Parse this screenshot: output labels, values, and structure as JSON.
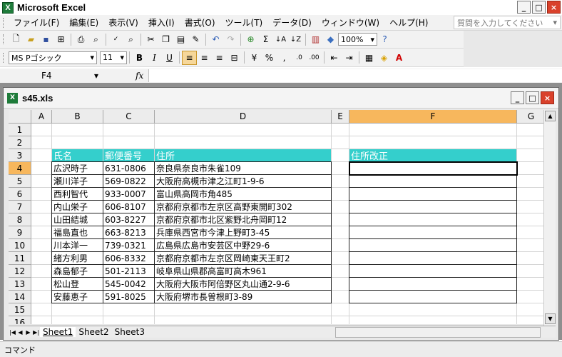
{
  "window": {
    "title": "Microsoft Excel"
  },
  "menu": [
    "ファイル(F)",
    "編集(E)",
    "表示(V)",
    "挿入(I)",
    "書式(O)",
    "ツール(T)",
    "データ(D)",
    "ウィンドウ(W)",
    "ヘルプ(H)"
  ],
  "help_placeholder": "質問を入力してください",
  "toolbar": {
    "zoom": "100%",
    "font_name": "MS Pゴシック",
    "font_size": "11"
  },
  "formula": {
    "name_box": "F4",
    "fx": "fx",
    "value": ""
  },
  "workbook": {
    "title": "s45.xls"
  },
  "sheet": {
    "columns": [
      "A",
      "B",
      "C",
      "D",
      "E",
      "F",
      "G"
    ],
    "rows": [
      "1",
      "2",
      "3",
      "4",
      "5",
      "6",
      "7",
      "8",
      "9",
      "10",
      "11",
      "12",
      "13",
      "14",
      "15",
      "16"
    ],
    "headers": {
      "name": "氏名",
      "postal": "郵便番号",
      "address": "住所",
      "fixed": "住所改正"
    },
    "records": [
      {
        "name": "広沢時子",
        "postal": "631-0806",
        "address": "奈良県奈良市朱雀109"
      },
      {
        "name": "瀬川洋子",
        "postal": "569-0822",
        "address": "大阪府高槻市津之江町1-9-6"
      },
      {
        "name": "西利智代",
        "postal": "933-0007",
        "address": "富山県高岡市角485"
      },
      {
        "name": "内山栄子",
        "postal": "606-8107",
        "address": "京都府京都市左京区高野東開町302"
      },
      {
        "name": "山田結城",
        "postal": "603-8227",
        "address": "京都府京都市北区紫野北舟岡町12"
      },
      {
        "name": "福島直也",
        "postal": "663-8213",
        "address": "兵庫県西宮市今津上野町3-45"
      },
      {
        "name": "川本洋一",
        "postal": "739-0321",
        "address": "広島県広島市安芸区中野29-6"
      },
      {
        "name": "緒方利男",
        "postal": "606-8332",
        "address": "京都府京都市左京区岡崎東天王町2"
      },
      {
        "name": "森島郁子",
        "postal": "501-2113",
        "address": "岐阜県山県郡高富町高木961"
      },
      {
        "name": "松山登",
        "postal": "545-0042",
        "address": "大阪府大阪市阿倍野区丸山通2-9-6"
      },
      {
        "name": "安藤恵子",
        "postal": "591-8025",
        "address": "大阪府堺市長曽根町3-89"
      }
    ]
  },
  "tabs": [
    "Sheet1",
    "Sheet2",
    "Sheet3"
  ],
  "status": "コマンド",
  "colors": {
    "header_fill": "#34cfcc",
    "selected_col": "#f7b75d"
  }
}
